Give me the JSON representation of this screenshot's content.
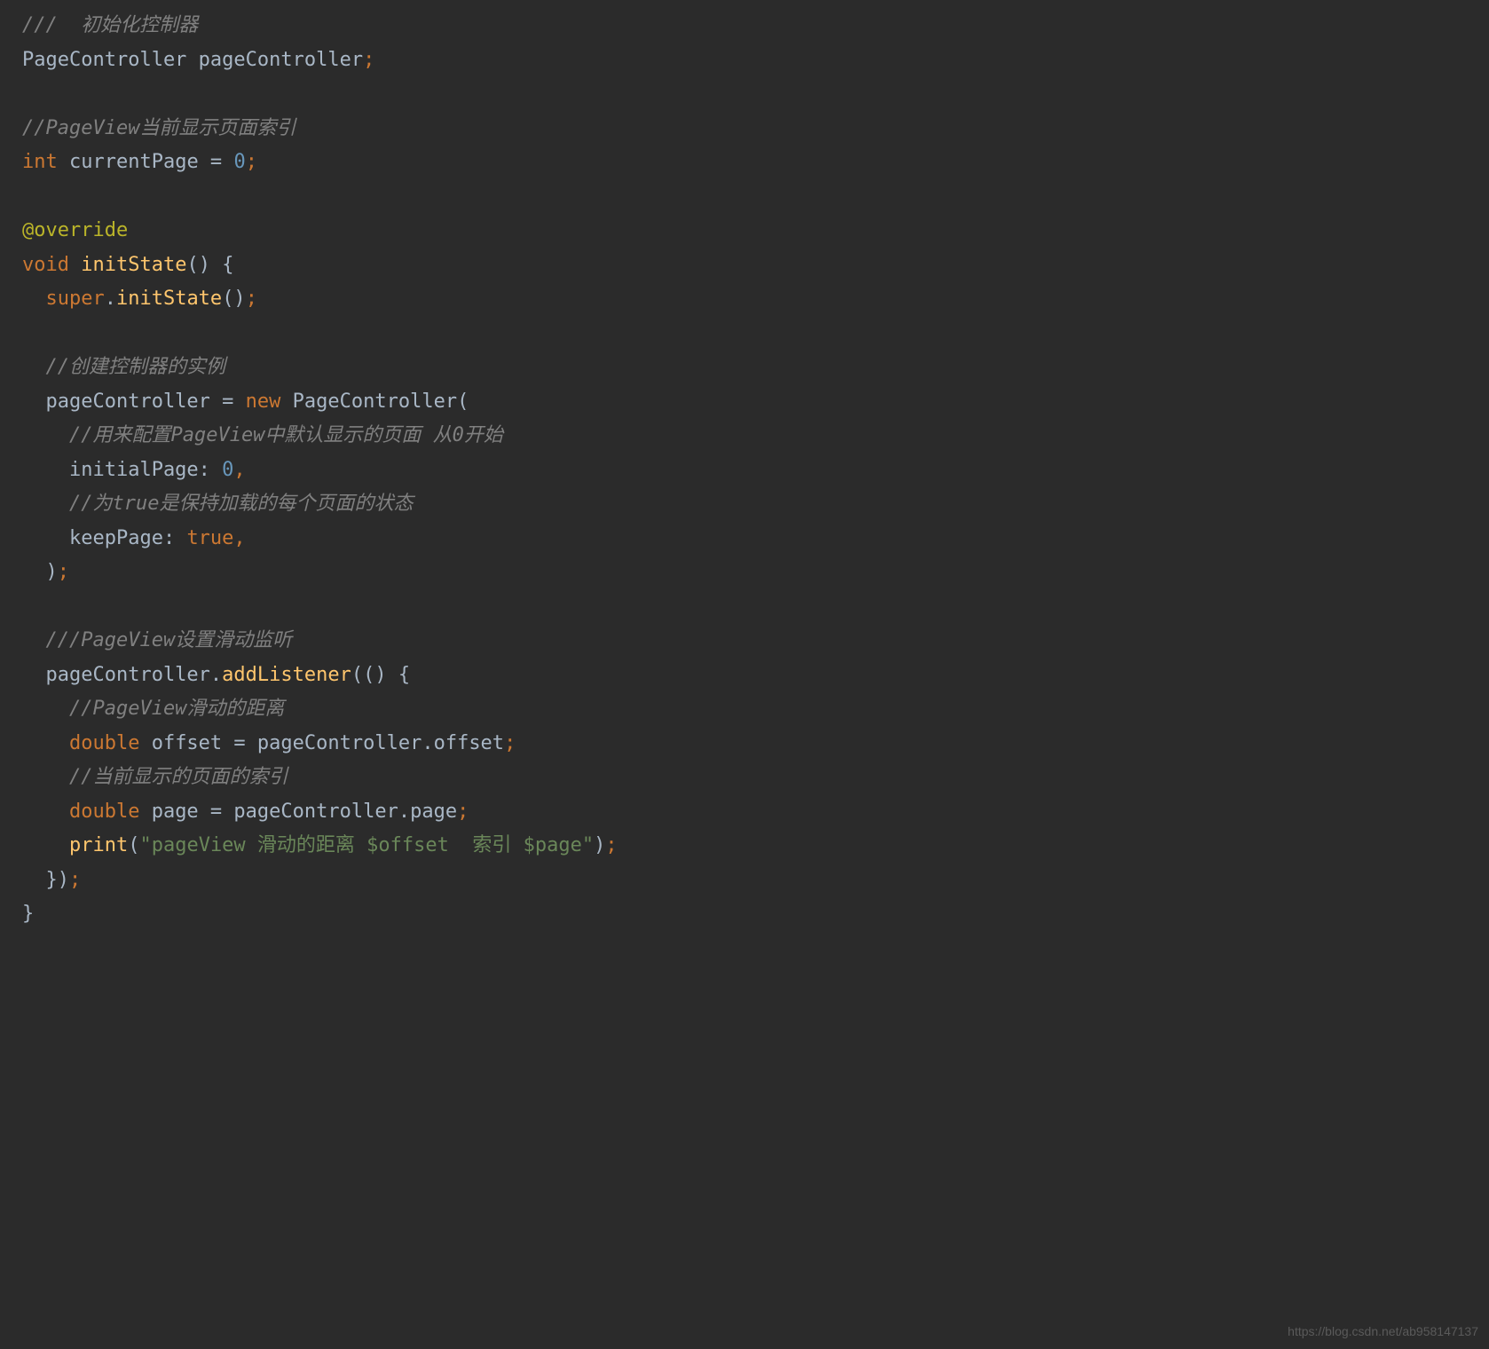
{
  "code": {
    "line1_comment": "///  初始化控制器",
    "line2_type": "PageController",
    "line2_var": " pageController",
    "line2_semi": ";",
    "line4_comment": "//PageView当前显示页面索引",
    "line5_type": "int",
    "line5_var": " currentPage = ",
    "line5_num": "0",
    "line5_semi": ";",
    "line7_annotation": "@override",
    "line8_void": "void ",
    "line8_method": "initState",
    "line8_rest": "() {",
    "line9_super": "  super",
    "line9_dot": ".",
    "line9_method": "initState",
    "line9_rest": "()",
    "line9_semi": ";",
    "line11_comment": "  //创建控制器的实例",
    "line12_var": "  pageController = ",
    "line12_new": "new ",
    "line12_type": "PageController",
    "line12_rest": "(",
    "line13_comment": "    //用来配置PageView中默认显示的页面 从0开始",
    "line14_pre": "    initialPage: ",
    "line14_num": "0",
    "line14_comma": ",",
    "line15_comment": "    //为true是保持加载的每个页面的状态",
    "line16_pre": "    keepPage: ",
    "line16_true": "true",
    "line16_comma": ",",
    "line17_close": "  )",
    "line17_semi": ";",
    "line19_comment": "  ///PageView设置滑动监听",
    "line20_pre": "  pageController.",
    "line20_method": "addListener",
    "line20_rest": "(() {",
    "line21_comment": "    //PageView滑动的距离",
    "line22_type": "    double",
    "line22_rest": " offset = pageController.offset",
    "line22_semi": ";",
    "line23_comment": "    //当前显示的页面的索引",
    "line24_type": "    double",
    "line24_rest": " page = pageController.page",
    "line24_semi": ";",
    "line25_pre": "    ",
    "line25_method": "print",
    "line25_paren": "(",
    "line25_string": "\"pageView 滑动的距离 $offset  索引 $page\"",
    "line25_close": ")",
    "line25_semi": ";",
    "line26_close": "  })",
    "line26_semi": ";",
    "line27_close": "}"
  },
  "watermark": "https://blog.csdn.net/ab958147137"
}
